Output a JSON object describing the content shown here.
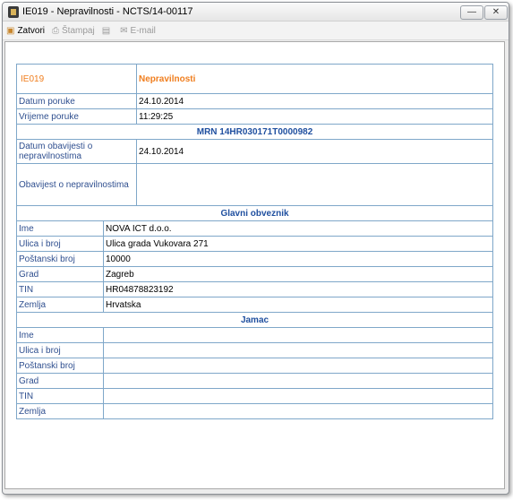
{
  "window": {
    "title": "IE019 - Nepravilnosti - NCTS/14-00117"
  },
  "toolbar": {
    "close_label": "Zatvori",
    "print_label": "Štampaj",
    "email_label": "E-mail"
  },
  "header": {
    "code": "IE019",
    "title": "Nepravilnosti"
  },
  "fields": {
    "datum_poruke_label": "Datum poruke",
    "datum_poruke": "24.10.2014",
    "vrijeme_poruke_label": "Vrijeme poruke",
    "vrijeme_poruke": "11:29:25",
    "mrn": "MRN 14HR030171T0000982",
    "datum_obavijesti_label": "Datum obavijesti o nepravilnostima",
    "datum_obavijesti": "24.10.2014",
    "obavijest_label": "Obavijest o nepravilnostima",
    "obavijest": ""
  },
  "glavni": {
    "heading": "Glavni obveznik",
    "ime_label": "Ime",
    "ime": "NOVA ICT d.o.o.",
    "ulica_label": "Ulica i broj",
    "ulica": "Ulica grada Vukovara 271",
    "postanski_label": "Poštanski broj",
    "postanski": "10000",
    "grad_label": "Grad",
    "grad": "Zagreb",
    "tin_label": "TIN",
    "tin": "HR04878823192",
    "zemlja_label": "Zemlja",
    "zemlja": "Hrvatska"
  },
  "jamac": {
    "heading": "Jamac",
    "ime_label": "Ime",
    "ime": "",
    "ulica_label": "Ulica i broj",
    "ulica": "",
    "postanski_label": "Poštanski broj",
    "postanski": "",
    "grad_label": "Grad",
    "grad": "",
    "tin_label": "TIN",
    "tin": "",
    "zemlja_label": "Zemlja",
    "zemlja": ""
  }
}
